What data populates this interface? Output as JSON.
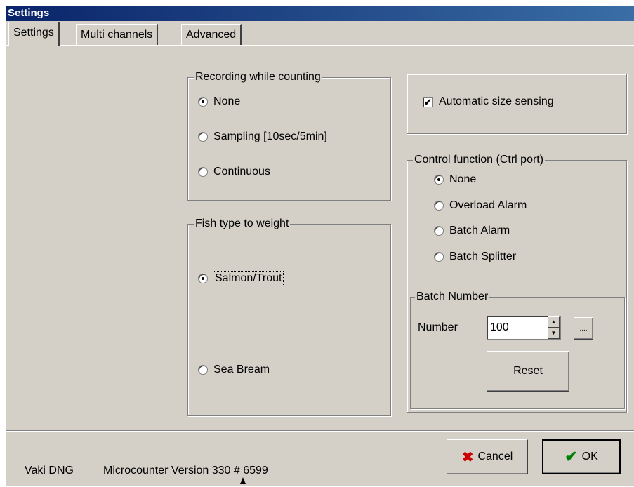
{
  "window": {
    "title": "Settings"
  },
  "tabs": [
    {
      "label": "Settings",
      "active": true
    },
    {
      "label": "Multi channels",
      "active": false
    },
    {
      "label": "Advanced",
      "active": false
    }
  ],
  "recording": {
    "legend": "Recording while counting",
    "options": [
      {
        "label": "None",
        "selected": true
      },
      {
        "label": "Sampling [10sec/5min]",
        "selected": false
      },
      {
        "label": "Continuous",
        "selected": false
      }
    ]
  },
  "fish_type": {
    "legend": "Fish type to weight",
    "options": [
      {
        "label": "Salmon/Trout",
        "selected": true
      },
      {
        "label": "Sea Bream",
        "selected": false
      }
    ]
  },
  "auto_size": {
    "label": "Automatic size sensing",
    "checked": true,
    "check_glyph": "✔"
  },
  "control": {
    "legend": "Control function (Ctrl port)",
    "options": [
      {
        "label": "None",
        "selected": true
      },
      {
        "label": "Overload Alarm",
        "selected": false
      },
      {
        "label": "Batch Alarm",
        "selected": false
      },
      {
        "label": "Batch Splitter",
        "selected": false
      }
    ]
  },
  "batch": {
    "legend": "Batch Number",
    "number_label": "Number",
    "number_value": "100",
    "browse_label": "....",
    "reset_label": "Reset"
  },
  "footer": {
    "company": "Vaki DNG",
    "version": "Microcounter Version 330 # 6599",
    "cancel_label": "Cancel",
    "ok_label": "OK",
    "cancel_icon_color": "#cc0000",
    "ok_icon_color": "#008000"
  },
  "icons": {
    "cancel": "x-icon",
    "ok": "checkmark-icon",
    "spin_up": "triangle-up-icon",
    "spin_down": "triangle-down-icon",
    "cursor": "mouse-pointer-icon"
  }
}
